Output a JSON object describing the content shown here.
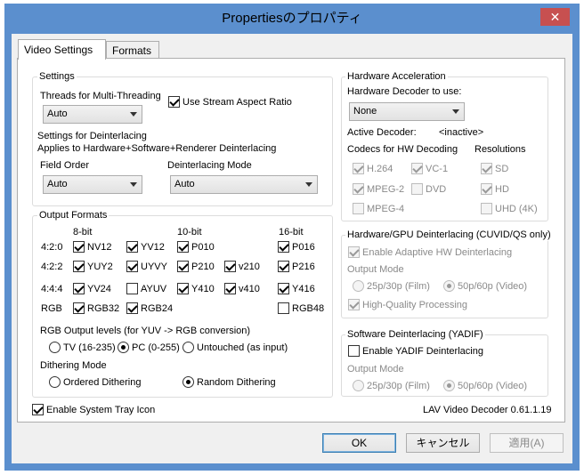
{
  "window": {
    "title": "Propertiesのプロパティ",
    "close_glyph": "✕"
  },
  "tabs": [
    "Video Settings",
    "Formats"
  ],
  "settings": {
    "title": "Settings",
    "threads_label": "Threads for Multi-Threading",
    "threads_value": "Auto",
    "stream_aspect": "Use Stream Aspect Ratio",
    "deint_heading": "Settings for Deinterlacing",
    "deint_applies": "Applies to Hardware+Software+Renderer Deinterlacing",
    "field_order_label": "Field Order",
    "field_order_value": "Auto",
    "deint_mode_label": "Deinterlacing Mode",
    "deint_mode_value": "Auto"
  },
  "output": {
    "title": "Output Formats",
    "col_8bit": "8-bit",
    "col_10bit": "10-bit",
    "col_16bit": "16-bit",
    "row_420": "4:2:0",
    "row_422": "4:2:2",
    "row_444": "4:4:4",
    "row_rgb": "RGB",
    "nv12": "NV12",
    "yv12": "YV12",
    "p010": "P010",
    "p016": "P016",
    "yuy2": "YUY2",
    "uyvy": "UYVY",
    "p210": "P210",
    "v210": "v210",
    "p216": "P216",
    "yv24": "YV24",
    "ayuv": "AYUV",
    "y410": "Y410",
    "v410": "v410",
    "y416": "Y416",
    "rgb32": "RGB32",
    "rgb24": "RGB24",
    "rgb48": "RGB48",
    "levels_label": "RGB Output levels (for YUV -> RGB conversion)",
    "tv": "TV (16-235)",
    "pc": "PC (0-255)",
    "untouched": "Untouched (as input)",
    "dither_label": "Dithering Mode",
    "ordered": "Ordered Dithering",
    "random": "Random Dithering"
  },
  "hw": {
    "title": "Hardware Acceleration",
    "decoder_label": "Hardware Decoder to use:",
    "decoder_value": "None",
    "active_label": "Active Decoder:",
    "active_value": "<inactive>",
    "codecs_label": "Codecs for HW Decoding",
    "resolutions_label": "Resolutions",
    "h264": "H.264",
    "vc1": "VC-1",
    "mpeg2": "MPEG-2",
    "dvd": "DVD",
    "mpeg4": "MPEG-4",
    "sd": "SD",
    "hd": "HD",
    "uhd": "UHD (4K)"
  },
  "hwdeint": {
    "title": "Hardware/GPU Deinterlacing (CUVID/QS only)",
    "enable": "Enable Adaptive HW Deinterlacing",
    "output_mode": "Output Mode",
    "film": "25p/30p (Film)",
    "video": "50p/60p (Video)",
    "hq": "High-Quality Processing"
  },
  "swdeint": {
    "title": "Software Deinterlacing (YADIF)",
    "enable": "Enable YADIF Deinterlacing",
    "output_mode": "Output Mode",
    "film": "25p/30p (Film)",
    "video": "50p/60p (Video)"
  },
  "footer": {
    "tray": "Enable System Tray Icon",
    "version": "LAV Video Decoder 0.61.1.19"
  },
  "buttons": {
    "ok": "OK",
    "cancel": "キャンセル",
    "apply": "適用(A)"
  }
}
